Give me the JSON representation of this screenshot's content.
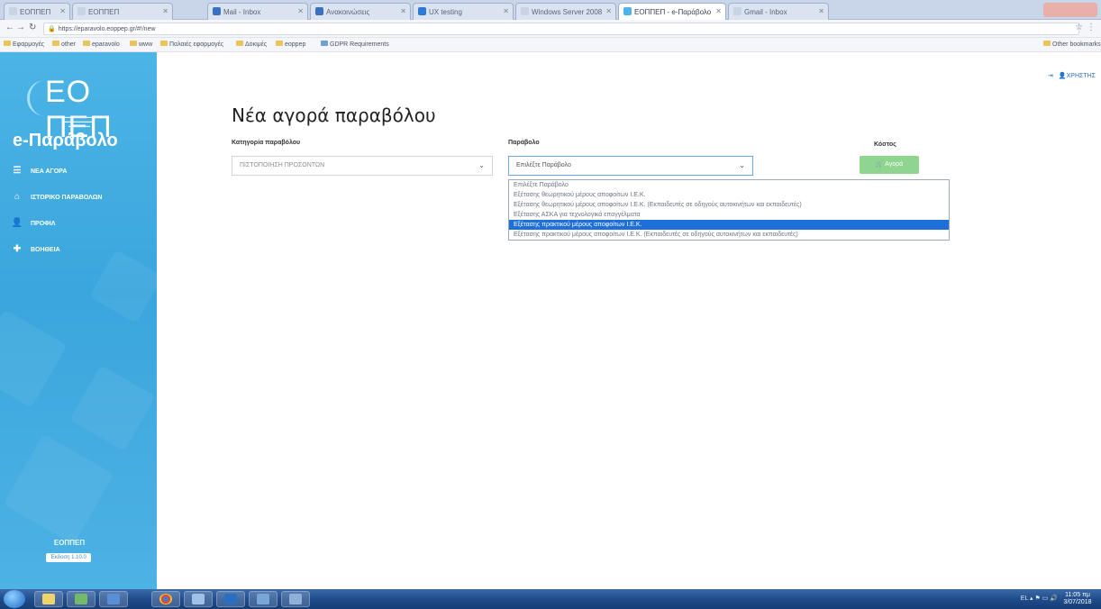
{
  "browser": {
    "tabs": [
      {
        "label": "ΕΟΠΠΕΠ",
        "color": "#d6e0ef"
      },
      {
        "label": "ΕΟΠΠΕΠ",
        "color": "#d6e0ef"
      },
      {
        "label": "Mail - Inbox",
        "color": "#3b6fc2"
      },
      {
        "label": "Ανακοινώσεις",
        "color": "#3b6fc2"
      },
      {
        "label": "UX testing",
        "color": "#2a7ad6"
      },
      {
        "label": "Windows Server 2008",
        "color": "#d6e0ef"
      },
      {
        "label": "ΕΟΠΠΕΠ - e-Παράβολο",
        "color": "#d6e0ef"
      },
      {
        "label": "Gmail - Inbox",
        "color": "#d6e0ef"
      }
    ],
    "url": "https://eparavolo.eoppep.gr/#!/new",
    "bookmarks": [
      "Εφαρμογές",
      "other",
      "eparavolo",
      "www",
      "Παλαιές εφαρμογές",
      "Δοκιμές",
      "eoppep",
      "GDPR Requirements"
    ],
    "other_bookmarks": "Other bookmarks"
  },
  "sidebar": {
    "logo_text": "ΕΟ ΠΕΠ",
    "app_title": "e-Παράβολο",
    "items": [
      {
        "icon": "list-icon",
        "label": "ΝΕΑ ΑΓΟΡΑ"
      },
      {
        "icon": "home-icon",
        "label": "ΙΣΤΟΡΙΚΟ ΠΑΡΑΒΟΛΩΝ"
      },
      {
        "icon": "user-icon",
        "label": "ΠΡΟΦΙΛ"
      },
      {
        "icon": "help-icon",
        "label": "ΒΟΗΘΕΙΑ"
      }
    ],
    "footer_brand": "ΕΟΠΠΕΠ",
    "version": "Έκδοση 1.10.0"
  },
  "main": {
    "user_link": "ΧΡΗΣΤΗΣ",
    "page_title": "Νέα αγορά παραβόλου",
    "category_label": "Κατηγορία παραβόλου",
    "category_value": "ΠΙΣΤΟΠΟΙΗΣΗ ΠΡΟΣΟΝΤΩΝ",
    "fee_label": "Παράβολο",
    "fee_value": "Επιλέξτε Παράβολο",
    "cost_label": "Κόστος",
    "buy_button": "Αγορά",
    "options": [
      "Επιλέξτε Παράβολο",
      "Εξέτασης θεωρητικού μέρους αποφοίτων Ι.Ε.Κ.",
      "Εξέτασης θεωρητικού μέρους αποφοίτων Ι.Ε.Κ. (Εκπαιδευτές σε οδηγούς αυτοκινήτων και εκπαιδευτές)",
      "Εξέτασης ΑΣΚΑ για τεχνολογικά επαγγέλματα",
      "Εξέτασης πρακτικού μέρους αποφοίτων Ι.Ε.Κ.",
      "Εξέτασης πρακτικού μέρους αποφοίτων Ι.Ε.Κ. (Εκπαιδευτές σε οδηγούς αυτοκινήτων και εκπαιδευτές)"
    ],
    "selected_option_index": 4
  },
  "taskbar": {
    "tray_text": "EL",
    "time": "11:05 πμ",
    "date": "3/07/2018"
  }
}
